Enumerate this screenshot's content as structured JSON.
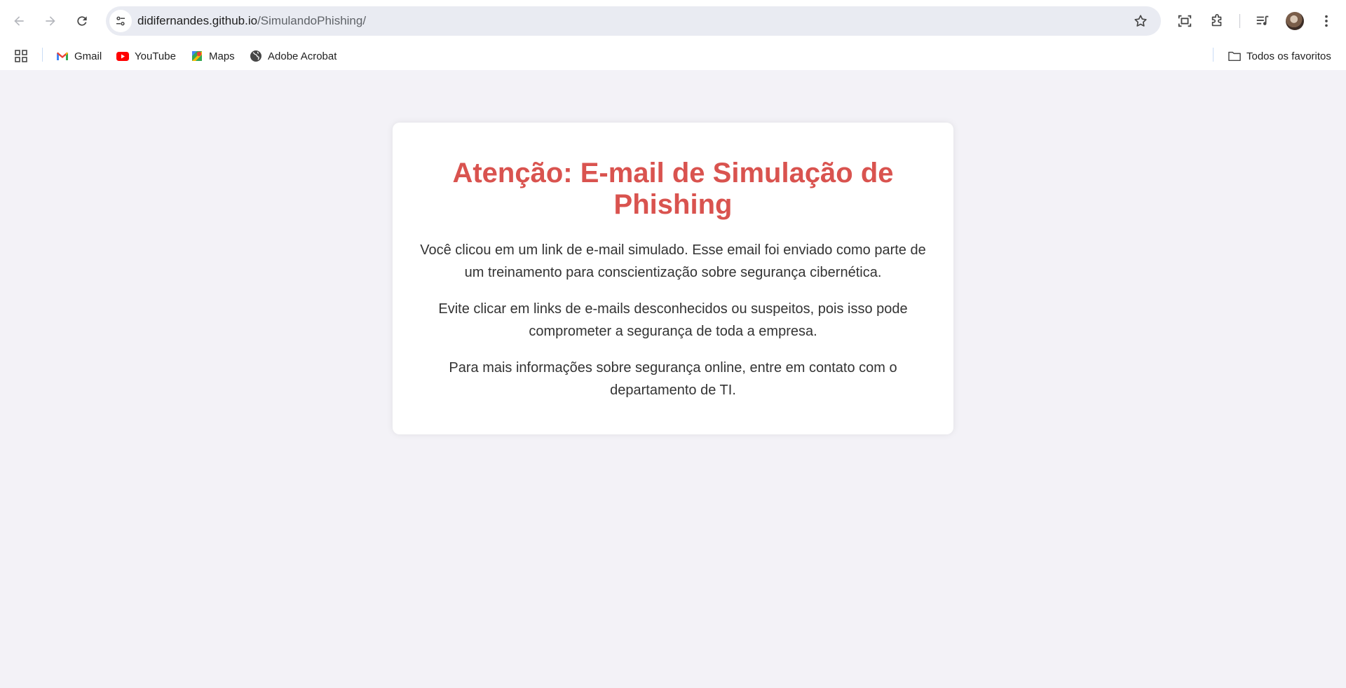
{
  "browser": {
    "url_host": "didifernandes.github.io",
    "url_path": "/SimulandoPhishing/"
  },
  "bookmarks": {
    "items": [
      {
        "label": "Gmail",
        "icon": "gmail-icon"
      },
      {
        "label": "YouTube",
        "icon": "youtube-icon"
      },
      {
        "label": "Maps",
        "icon": "maps-icon"
      },
      {
        "label": "Adobe Acrobat",
        "icon": "globe-icon"
      }
    ],
    "all_bookmarks": "Todos os favoritos"
  },
  "page": {
    "title": "Atenção: E-mail de Simulação de Phishing",
    "paragraphs": [
      "Você clicou em um link de e-mail simulado. Esse email foi enviado como parte de um treinamento para conscientização sobre segurança cibernética.",
      "Evite clicar em links de e-mails desconhecidos ou suspeitos, pois isso pode comprometer a segurança de toda a empresa.",
      "Para mais informações sobre segurança online, entre em contato com o departamento de TI."
    ]
  },
  "colors": {
    "title": "#d9534f",
    "text": "#333333",
    "background": "#f3f2f7",
    "card": "#ffffff"
  }
}
